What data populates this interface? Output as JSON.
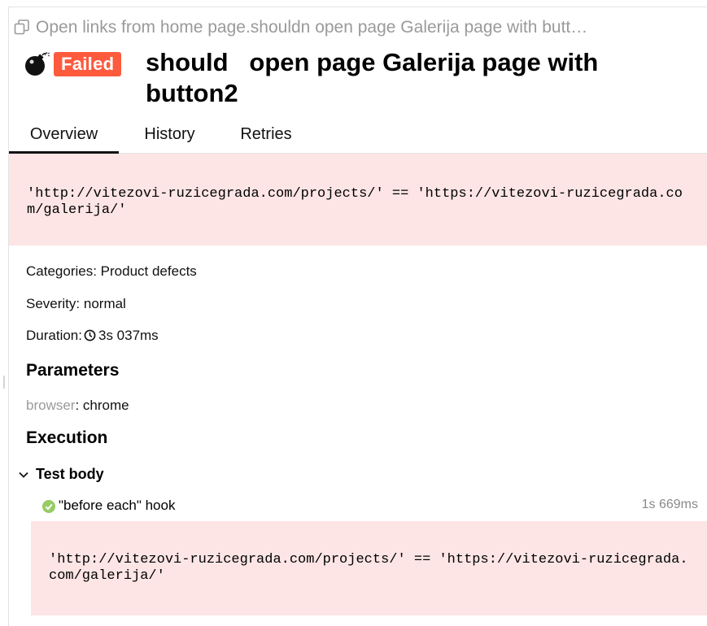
{
  "breadcrumb": {
    "icon": "copy-icon",
    "text": "Open links from home page.shouldn open page Galerija page with butt…"
  },
  "header": {
    "status_icon": "bomb-icon",
    "status_label": "Failed",
    "status_color": "#fd5a3e",
    "title": "should   open page Galerija page with button2"
  },
  "tabs": [
    {
      "label": "Overview",
      "active": true
    },
    {
      "label": "History",
      "active": false
    },
    {
      "label": "Retries",
      "active": false
    }
  ],
  "error_message": "'http://vitezovi-ruzicegrada.com/projects/' == 'https://vitezovi-ruzicegrada.com/galerija/'",
  "error_bg_color": "#fde5e5",
  "categories": {
    "label": "Categories:",
    "value": "Product defects"
  },
  "severity": {
    "label": "Severity:",
    "value": "normal"
  },
  "duration": {
    "label": "Duration:",
    "icon": "clock-icon",
    "value": "3s 037ms"
  },
  "parameters": {
    "title": "Parameters",
    "items": [
      {
        "name": "browser",
        "value": "chrome"
      }
    ]
  },
  "execution": {
    "title": "Execution",
    "test_body": {
      "label": "Test body",
      "icon": "chevron-down-icon",
      "steps": [
        {
          "icon": "check-circle-icon",
          "icon_color": "#97cc64",
          "name": "\"before each\" hook",
          "duration": "1s 669ms",
          "error": "'http://vitezovi-ruzicegrada.com/projects/' == 'https://vitezovi-ruzicegrada.com/galerija/'"
        }
      ]
    }
  }
}
